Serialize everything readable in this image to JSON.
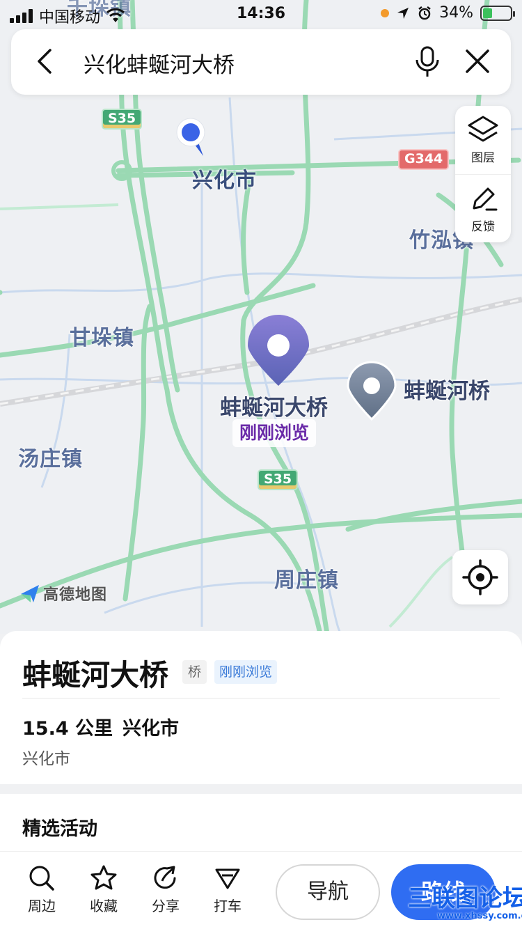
{
  "status_bar": {
    "carrier": "中国移动",
    "time": "14:36",
    "battery": "34%",
    "battery_level": 0.34
  },
  "search": {
    "query": "兴化蚌蜒河大桥"
  },
  "map": {
    "places": {
      "xinghua": "兴化市",
      "zhuhong": "竹泓镇",
      "gandu": "甘垛镇",
      "tangzhuang": "汤庄镇",
      "zhouzhuang": "周庄镇",
      "top_partial": "千垛镇"
    },
    "highways": {
      "s35_top": "S35",
      "s35_mid": "S35",
      "g344": "G344"
    },
    "selected_pin": {
      "label": "蚌蜒河大桥",
      "tag": "刚刚浏览"
    },
    "other_pin": {
      "label": "蚌蜒河桥"
    },
    "brand": "高德地图",
    "tools": {
      "layers": "图层",
      "feedback": "反馈"
    }
  },
  "card": {
    "title": "蚌蜒河大桥",
    "category_badge": "桥",
    "recent_badge": "刚刚浏览",
    "distance": "15.4 公里",
    "city": "兴化市",
    "address": "兴化市"
  },
  "activity": {
    "title": "精选活动"
  },
  "bottom_nav": {
    "nearby": "周边",
    "favorite": "收藏",
    "share": "分享",
    "taxi": "打车",
    "navigate": "导航",
    "route": "路线"
  },
  "watermark": {
    "text": "三联图论坛",
    "url": "www.xhssy.com.cn"
  },
  "colors": {
    "accent_blue": "#2f6df2",
    "road_green": "#9ad9b3",
    "map_bg": "#eef0f3",
    "pin_purple": "#6f6fc0",
    "tag_purple": "#6a2aa8"
  }
}
